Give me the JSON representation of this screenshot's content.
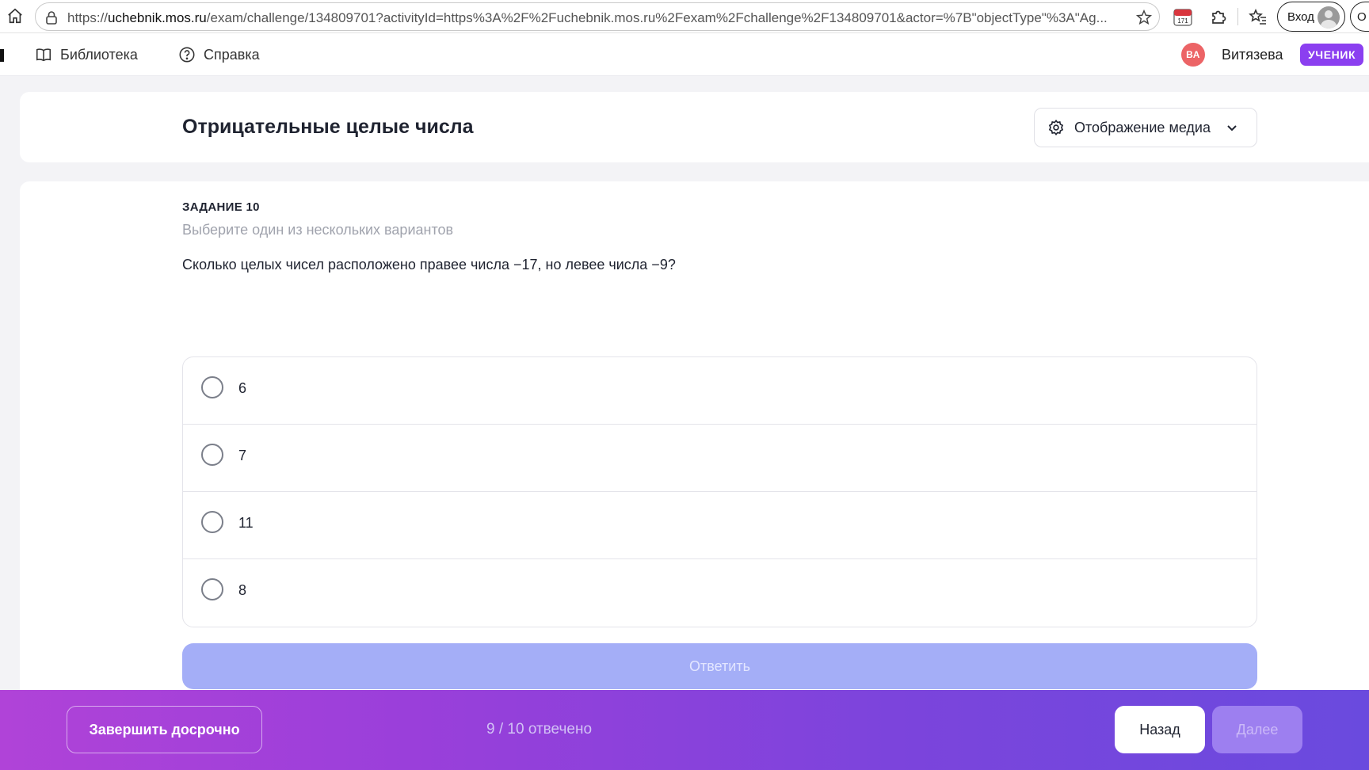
{
  "browser": {
    "url_host": "uchebnik.mos.ru",
    "url_scheme": "https://",
    "url_path": "/exam/challenge/134809701?activityId=https%3A%2F%2Fuchebnik.mos.ru%2Fexam%2Fchallenge%2F134809701&actor=%7B\"objectType\"%3A\"Ag...",
    "calendar_badge": "171",
    "signin_label": "Вход",
    "cutoff_label": "О"
  },
  "nav": {
    "library_label": "Библиотека",
    "help_label": "Справка",
    "user_initials": "ВА",
    "user_name": "Витязева",
    "role_badge": "УЧЕНИК"
  },
  "header": {
    "title": "Отрицательные целые числа",
    "media_button_label": "Отображение медиа"
  },
  "task": {
    "number_label": "ЗАДАНИЕ 10",
    "hint": "Выберите один из нескольких вариантов",
    "question": "Сколько целых чисел расположено правее числа −17, но левее числа −9?",
    "options": [
      {
        "label": "6"
      },
      {
        "label": "7"
      },
      {
        "label": "11"
      },
      {
        "label": "8"
      }
    ],
    "answer_button_label": "Ответить"
  },
  "footer": {
    "finish_label": "Завершить досрочно",
    "progress_text": "9 / 10 отвечено",
    "back_label": "Назад",
    "next_label": "Далее"
  },
  "colors": {
    "accent": "#8b3ff0",
    "avatar": "#ec6466",
    "answer_button": "#a4aef7",
    "bottom_gradient_start": "#b043d8",
    "bottom_gradient_end": "#6a4ade"
  }
}
